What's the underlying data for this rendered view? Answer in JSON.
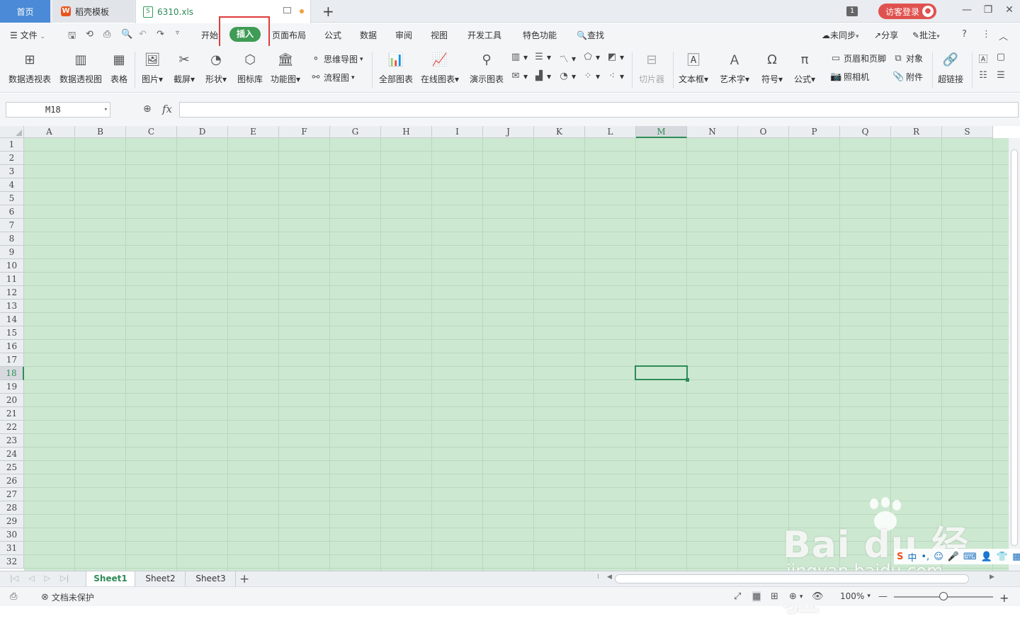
{
  "tabs": {
    "home": "首页",
    "template": "稻壳模板",
    "file": "6310.xls",
    "add": "+"
  },
  "titlebar": {
    "badge": "1",
    "login": "访客登录"
  },
  "menu": {
    "file": "文件",
    "items": [
      "开始",
      "插入",
      "页面布局",
      "公式",
      "数据",
      "审阅",
      "视图",
      "开发工具",
      "特色功能"
    ],
    "active": "插入",
    "search": "查找",
    "sync": "未同步",
    "share": "分享",
    "comment": "批注"
  },
  "ribbon": {
    "pivot_table": "数据透视表",
    "pivot_chart": "数据透视图",
    "table": "表格",
    "picture": "图片",
    "screenshot": "截屏",
    "shape": "形状",
    "icon_lib": "图标库",
    "func_chart": "功能图",
    "mindmap": "思维导图",
    "flowchart": "流程图",
    "all_charts": "全部图表",
    "online_charts": "在线图表",
    "demo_chart": "演示图表",
    "slicer": "切片器",
    "textbox": "文本框",
    "wordart": "艺术字",
    "symbol": "符号",
    "formula": "公式",
    "header_footer": "页眉和页脚",
    "object": "对象",
    "camera": "照相机",
    "attachment": "附件",
    "hyperlink": "超链接"
  },
  "formula_bar": {
    "name_box": "M18",
    "fx": "fx",
    "value": ""
  },
  "grid": {
    "columns": [
      "A",
      "B",
      "C",
      "D",
      "E",
      "F",
      "G",
      "H",
      "I",
      "J",
      "K",
      "L",
      "M",
      "N",
      "O",
      "P",
      "Q",
      "R",
      "S"
    ],
    "rows": [
      "1",
      "2",
      "3",
      "4",
      "5",
      "6",
      "7",
      "8",
      "9",
      "10",
      "11",
      "12",
      "13",
      "14",
      "15",
      "16",
      "17",
      "18",
      "19",
      "20",
      "21",
      "22",
      "23",
      "24",
      "25",
      "26",
      "27",
      "28",
      "29",
      "30",
      "31",
      "32"
    ],
    "active_column": "M",
    "active_row": "18",
    "cell_color": "#cde8d1"
  },
  "sheets": {
    "tabs": [
      "Sheet1",
      "Sheet2",
      "Sheet3"
    ],
    "active": "Sheet1"
  },
  "status": {
    "protect": "文档未保护",
    "zoom": "100%"
  },
  "watermark": {
    "brand": "Bai du 经验",
    "url": "jingyan.baidu.com"
  },
  "colors": {
    "accent": "#2e8b57",
    "active_tab": "#3f9b55",
    "highlight": "#e03a3a",
    "home_tab": "#4a8ad6",
    "login": "#e0524f"
  }
}
